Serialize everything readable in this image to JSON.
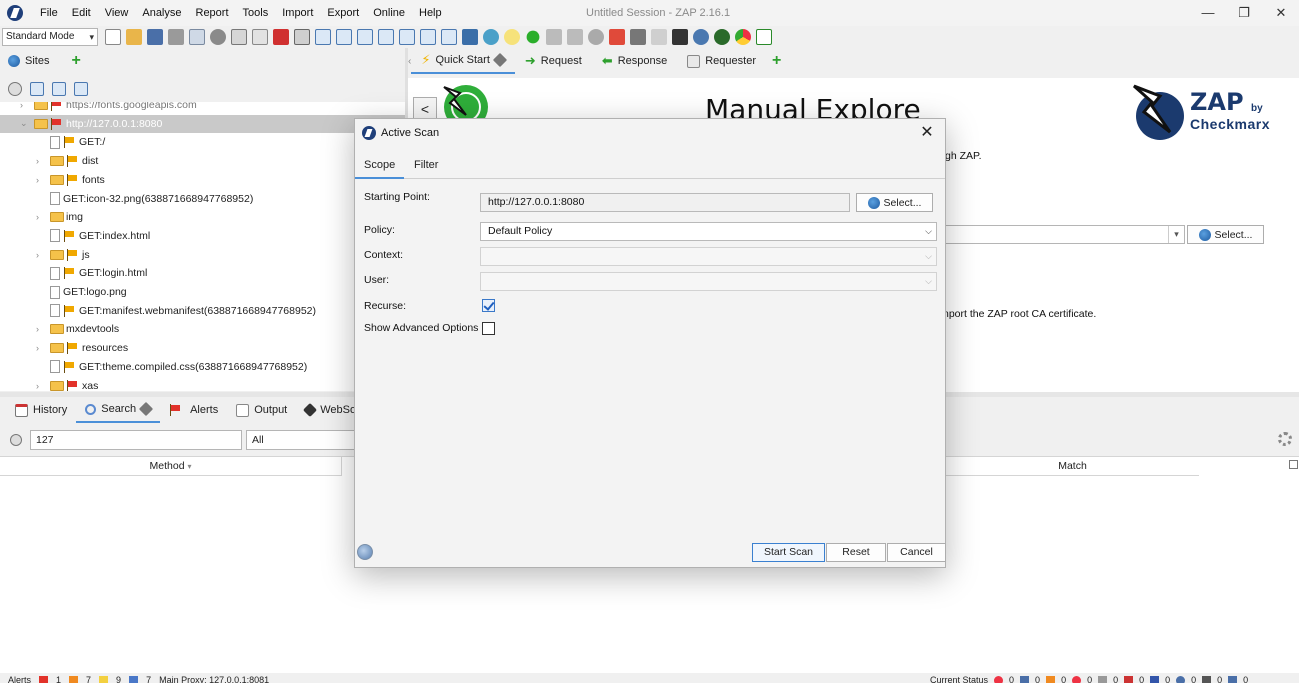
{
  "window": {
    "title": "Untitled Session - ZAP 2.16.1",
    "menu": [
      "File",
      "Edit",
      "View",
      "Analyse",
      "Report",
      "Tools",
      "Import",
      "Export",
      "Online",
      "Help"
    ],
    "controls": {
      "minimize": "—",
      "restore": "❐",
      "close": "✕"
    }
  },
  "toolbar": {
    "mode": "Standard Mode"
  },
  "sites": {
    "tab_label": "Sites",
    "tree": [
      {
        "label": "https://fonts.googleapis.com",
        "indent": 0,
        "type": "site",
        "partial": true
      },
      {
        "label": "http://127.0.0.1:8080",
        "indent": 0,
        "type": "site",
        "selected": true
      },
      {
        "label": "GET:/",
        "indent": 1,
        "type": "file"
      },
      {
        "label": "dist",
        "indent": 1,
        "type": "folder"
      },
      {
        "label": "fonts",
        "indent": 1,
        "type": "folder"
      },
      {
        "label": "GET:icon-32.png(638871668947768952)",
        "indent": 1,
        "type": "file-noflag"
      },
      {
        "label": "img",
        "indent": 1,
        "type": "folder-noflag"
      },
      {
        "label": "GET:index.html",
        "indent": 1,
        "type": "file"
      },
      {
        "label": "js",
        "indent": 1,
        "type": "folder"
      },
      {
        "label": "GET:login.html",
        "indent": 1,
        "type": "file"
      },
      {
        "label": "GET:logo.png",
        "indent": 1,
        "type": "file-noflag"
      },
      {
        "label": "GET:manifest.webmanifest(638871668947768952)",
        "indent": 1,
        "type": "file"
      },
      {
        "label": "mxdevtools",
        "indent": 1,
        "type": "folder-noflag"
      },
      {
        "label": "resources",
        "indent": 1,
        "type": "folder"
      },
      {
        "label": "GET:theme.compiled.css(638871668947768952)",
        "indent": 1,
        "type": "file"
      },
      {
        "label": "xas",
        "indent": 1,
        "type": "folder-red"
      }
    ]
  },
  "workspace": {
    "tabs": [
      "Quick Start",
      "Request",
      "Response",
      "Requester"
    ],
    "back_label": "<",
    "heading": "Manual Explore",
    "brand": {
      "zap": "ZAP",
      "by": "by",
      "company": "Checkmarx"
    },
    "partial_text_1": "gh ZAP.",
    "partial_text_2": "nport the ZAP root CA certificate.",
    "select_label": "Select..."
  },
  "bottom": {
    "tabs": [
      "History",
      "Search",
      "Alerts",
      "Output",
      "WebSock"
    ],
    "search_value": "127",
    "search_type": "All",
    "columns": {
      "method": "Method",
      "match": "Match"
    }
  },
  "status": {
    "alerts_label": "Alerts",
    "alert_counts": {
      "high": "1",
      "medium": "7",
      "low": "9",
      "info": "7"
    },
    "proxy": "Main Proxy: 127.0.0.1:8081",
    "current_status_label": "Current Status",
    "counts": [
      "0",
      "0",
      "0",
      "0",
      "0",
      "0",
      "0",
      "0",
      "0",
      "0"
    ]
  },
  "dialog": {
    "title": "Active Scan",
    "tabs": [
      "Scope",
      "Filter"
    ],
    "fields": {
      "starting_point_label": "Starting Point:",
      "starting_point": "http://127.0.0.1:8080",
      "select_label": "Select...",
      "policy_label": "Policy:",
      "policy": "Default Policy",
      "context_label": "Context:",
      "context": "",
      "user_label": "User:",
      "user": "",
      "recurse_label": "Recurse:",
      "recurse": true,
      "advanced_label": "Show Advanced Options",
      "advanced": false
    },
    "buttons": {
      "start": "Start Scan",
      "reset": "Reset",
      "cancel": "Cancel"
    }
  }
}
